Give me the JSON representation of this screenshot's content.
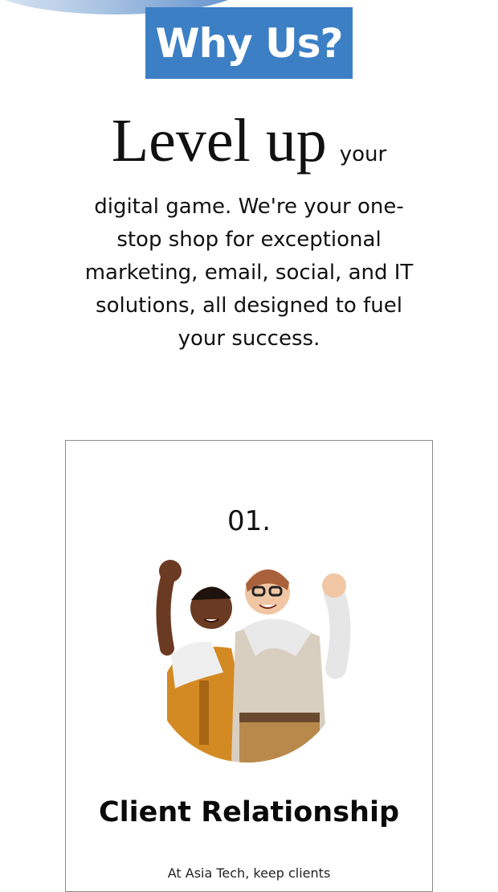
{
  "header": {
    "badge_text": "Why Us?"
  },
  "intro": {
    "highlight": "Level up",
    "text_line1": "your",
    "text_rest": "digital game. We're your one-stop shop for exceptional marketing, email, social, and IT solutions, all designed to fuel your success."
  },
  "card": {
    "number": "01.",
    "title": "Client Relationship",
    "text": "At Asia Tech, keep clients"
  },
  "colors": {
    "accent": "#3d7fc4",
    "arc": "#a9c3e3"
  }
}
